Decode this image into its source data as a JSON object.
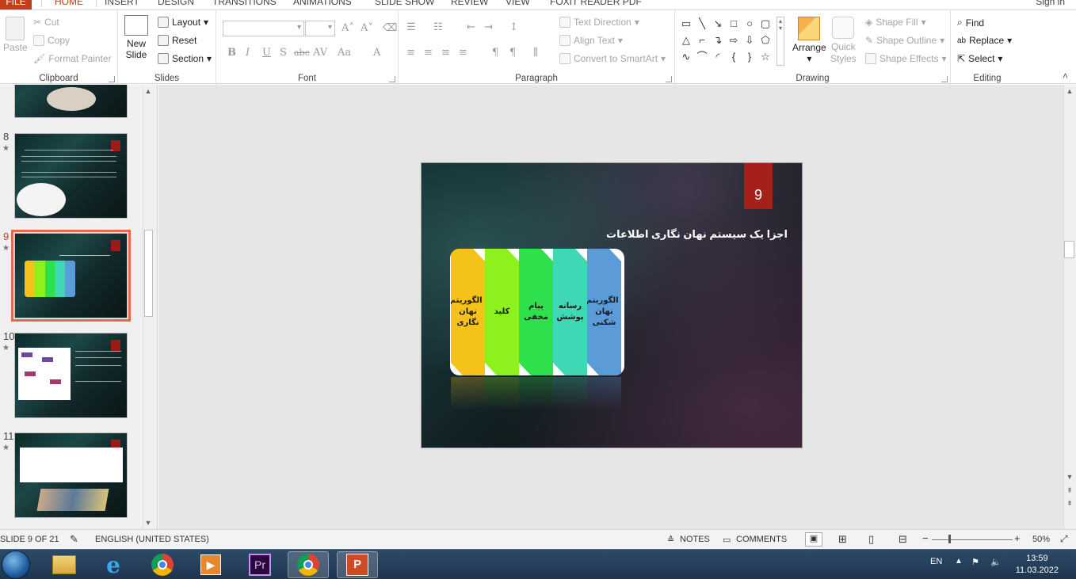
{
  "tabs": {
    "file": "FILE",
    "items": [
      "HOME",
      "INSERT",
      "DESIGN",
      "TRANSITIONS",
      "ANIMATIONS",
      "SLIDE SHOW",
      "REVIEW",
      "VIEW",
      "FOXIT READER PDF"
    ],
    "active": "HOME",
    "signin": "Sign in"
  },
  "ribbon": {
    "clipboard": {
      "label": "Clipboard",
      "paste": "Paste",
      "cut": "Cut",
      "copy": "Copy",
      "format_painter": "Format Painter"
    },
    "slides": {
      "label": "Slides",
      "new_slide_1": "New",
      "new_slide_2": "Slide",
      "layout": "Layout",
      "reset": "Reset",
      "section": "Section"
    },
    "font": {
      "label": "Font",
      "bold": "B",
      "italic": "I",
      "underline": "U",
      "shadow": "S",
      "strike": "abc",
      "spacing": "AV",
      "case": "Aa",
      "color": "A"
    },
    "paragraph": {
      "label": "Paragraph",
      "text_direction": "Text Direction",
      "align_text": "Align Text",
      "convert_smartart": "Convert to SmartArt"
    },
    "drawing": {
      "label": "Drawing",
      "arrange": "Arrange",
      "quick_styles_1": "Quick",
      "quick_styles_2": "Styles",
      "shape_fill": "Shape Fill",
      "shape_outline": "Shape Outline",
      "shape_effects": "Shape Effects"
    },
    "editing": {
      "label": "Editing",
      "find": "Find",
      "replace": "Replace",
      "select": "Select"
    }
  },
  "slide_panel": {
    "thumbs": [
      {
        "num": "8",
        "star": "★"
      },
      {
        "num": "9",
        "star": "★"
      },
      {
        "num": "10",
        "star": "★"
      },
      {
        "num": "11",
        "star": "★"
      }
    ]
  },
  "slide": {
    "number": "9",
    "title": "اجزا یک سیستم نهان نگاری اطلاعات",
    "chevrons": [
      {
        "text": "الگوریتم نهان نگاری",
        "color": "#f5c21a"
      },
      {
        "text": "کلید",
        "color": "#8ef01d"
      },
      {
        "text": "پیام مخفی",
        "color": "#2ee04b"
      },
      {
        "text": "رسانه پوشش",
        "color": "#3ed9b4"
      },
      {
        "text": "الگوریتم نهان شکنی",
        "color": "#5b9bd8"
      }
    ]
  },
  "status": {
    "slide_of": "SLIDE 9 OF 21",
    "language": "ENGLISH (UNITED STATES)",
    "notes": "NOTES",
    "comments": "COMMENTS",
    "zoom": "50%"
  },
  "taskbar": {
    "lang": "EN",
    "time": "13:59",
    "date": "11.03.2022",
    "premiere_label": "Pr"
  }
}
